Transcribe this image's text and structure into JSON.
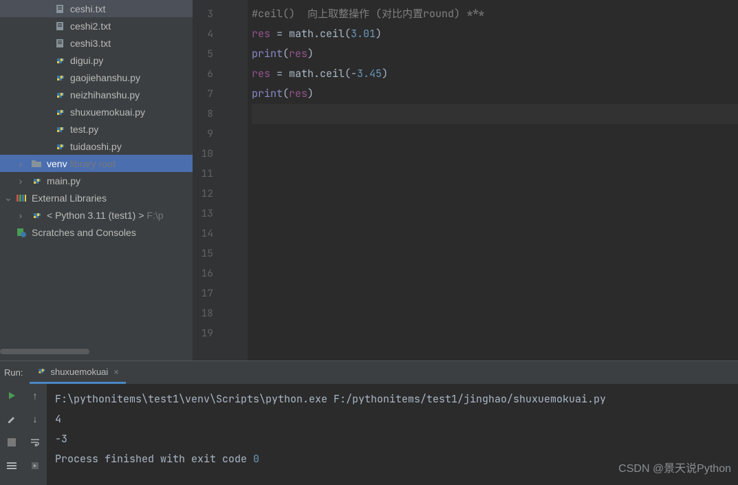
{
  "sidebar": {
    "files": [
      {
        "name": "ceshi.txt",
        "type": "txt"
      },
      {
        "name": "ceshi2.txt",
        "type": "txt"
      },
      {
        "name": "ceshi3.txt",
        "type": "txt"
      },
      {
        "name": "digui.py",
        "type": "py"
      },
      {
        "name": "gaojiehanshu.py",
        "type": "py"
      },
      {
        "name": "neizhihanshu.py",
        "type": "py"
      },
      {
        "name": "shuxuemokuai.py",
        "type": "py"
      },
      {
        "name": "test.py",
        "type": "py"
      },
      {
        "name": "tuidaoshi.py",
        "type": "py"
      }
    ],
    "venv": {
      "label": "venv",
      "suffix": "library root"
    },
    "main": {
      "label": "main.py"
    },
    "external": {
      "label": "External Libraries"
    },
    "python_env": {
      "label": "< Python 3.11 (test1) >",
      "path": "F:\\p"
    },
    "scratches": {
      "label": "Scratches and Consoles"
    }
  },
  "editor": {
    "gutter_start": 3,
    "gutter_end": 19,
    "current_line": 8,
    "code": {
      "line3": "#ceil()  向上取整操作 (对比内置round) ***",
      "line4_var": "res",
      "line4_mid": " = math.ceil(",
      "line4_num": "3.01",
      "line4_end": ")",
      "line5_fn": "print",
      "line5_open": "(",
      "line5_arg": "res",
      "line5_close": ")",
      "line6_var": "res",
      "line6_mid": " = math.ceil(",
      "line6_sign": "-",
      "line6_num": "3.45",
      "line6_end": ")",
      "line7_fn": "print",
      "line7_open": "(",
      "line7_arg": "res",
      "line7_close": ")"
    }
  },
  "run": {
    "label": "Run:",
    "tab_name": "shuxuemokuai",
    "console": {
      "cmd": "F:\\pythonitems\\test1\\venv\\Scripts\\python.exe F:/pythonitems/test1/jinghao/shuxuemokuai.py",
      "out1": "4",
      "out2": "-3",
      "exit_prefix": "Process finished with exit code ",
      "exit_code": "0"
    }
  },
  "watermark": "CSDN @景天说Python"
}
